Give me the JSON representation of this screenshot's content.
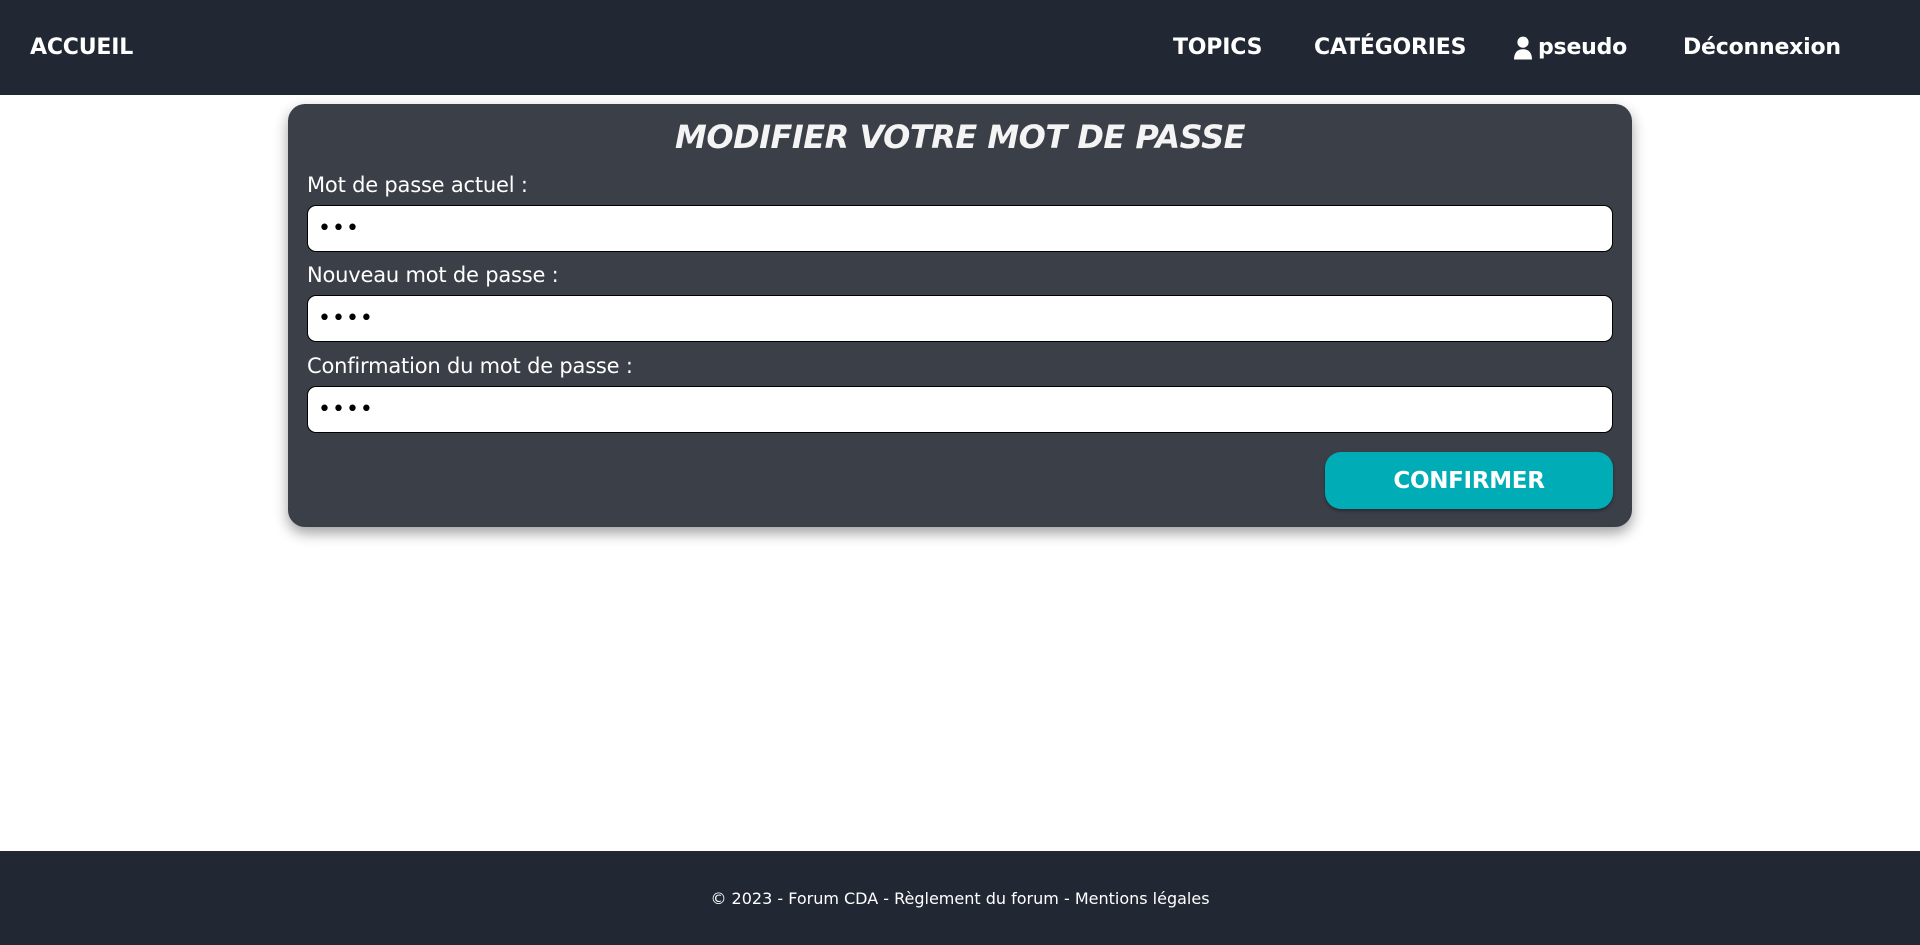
{
  "nav": {
    "home_label": "ACCUEIL",
    "topics_label": "TOPICS",
    "categories_label": "CATÉGORIES",
    "user_label": "pseudo",
    "user_icon": "user-icon",
    "logout_label": "Déconnexion"
  },
  "form": {
    "title": "MODIFIER VOTRE MOT DE PASSE",
    "current_password_label": "Mot de passe actuel :",
    "current_password_value": "•••",
    "new_password_label": "Nouveau mot de passe :",
    "new_password_value": "••••",
    "confirm_password_label": "Confirmation du mot de passe :",
    "confirm_password_value": "••••",
    "submit_label": "CONFIRMER"
  },
  "footer": {
    "copyright": "© 2023 - Forum CDA -",
    "rules_link": "Règlement du forum",
    "separator": "-",
    "legal_link": "Mentions légales"
  },
  "colors": {
    "nav_background": "#222833",
    "card_background": "#3b3f48",
    "accent": "#00acb6",
    "text": "#ffffff"
  }
}
